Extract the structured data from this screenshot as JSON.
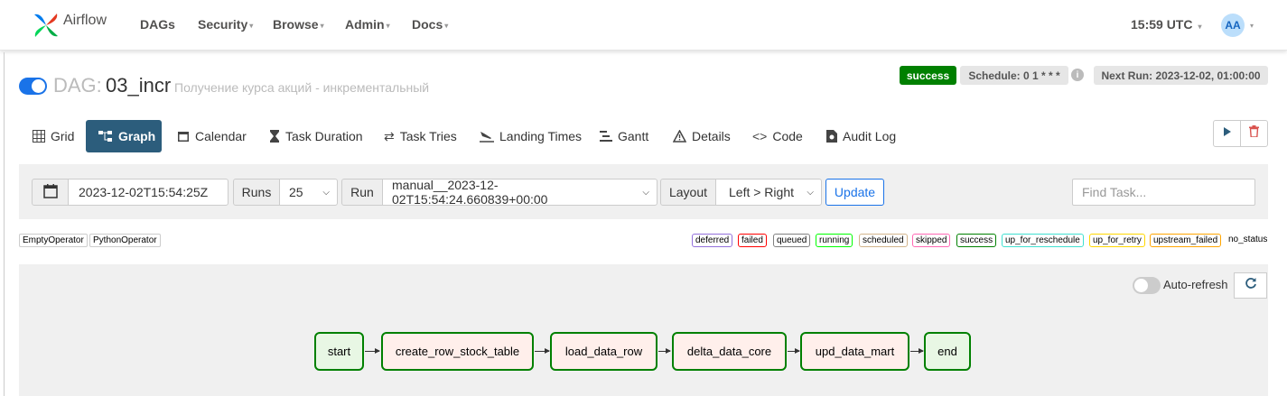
{
  "navbar": {
    "brand": "Airflow",
    "items": [
      "DAGs",
      "Security",
      "Browse",
      "Admin",
      "Docs"
    ],
    "time": "15:59 UTC",
    "avatar": "AA"
  },
  "dag": {
    "prefix": "DAG:",
    "id": "03_incr",
    "description": "Получение курса акций - инкрементальный",
    "status": "success",
    "schedule": "Schedule: 0 1 * * *",
    "next_run": "Next Run: 2023-12-02, 01:00:00",
    "paused": false
  },
  "tabs": [
    {
      "label": "Grid",
      "icon": "grid-icon"
    },
    {
      "label": "Graph",
      "icon": "graph-icon",
      "active": true
    },
    {
      "label": "Calendar",
      "icon": "calendar-icon"
    },
    {
      "label": "Task Duration",
      "icon": "hourglass-icon"
    },
    {
      "label": "Task Tries",
      "icon": "repeat-icon"
    },
    {
      "label": "Landing Times",
      "icon": "plane-icon"
    },
    {
      "label": "Gantt",
      "icon": "gantt-icon"
    },
    {
      "label": "Details",
      "icon": "warning-icon"
    },
    {
      "label": "Code",
      "icon": "code-icon"
    },
    {
      "label": "Audit Log",
      "icon": "file-icon"
    }
  ],
  "filters": {
    "date": "2023-12-02T15:54:25Z",
    "runs_label": "Runs",
    "runs_value": "25",
    "run_label": "Run",
    "run_value": "manual__2023-12-02T15:54:24.660839+00:00",
    "layout_label": "Layout",
    "layout_value": "Left > Right",
    "update_label": "Update",
    "find_placeholder": "Find Task..."
  },
  "operators": [
    {
      "label": "EmptyOperator",
      "color": "#e8f7e4"
    },
    {
      "label": "PythonOperator",
      "color": "#ffefeb"
    }
  ],
  "states": [
    {
      "label": "deferred",
      "color": "#9370db"
    },
    {
      "label": "failed",
      "color": "#ff0000"
    },
    {
      "label": "queued",
      "color": "#808080"
    },
    {
      "label": "running",
      "color": "#00ff00"
    },
    {
      "label": "scheduled",
      "color": "#d2b48c"
    },
    {
      "label": "skipped",
      "color": "#ff69b4"
    },
    {
      "label": "success",
      "color": "#008000"
    },
    {
      "label": "up_for_reschedule",
      "color": "#40e0d0"
    },
    {
      "label": "up_for_retry",
      "color": "#ffd700"
    },
    {
      "label": "upstream_failed",
      "color": "#ffa500"
    },
    {
      "label": "no_status",
      "color": "#ffffff"
    }
  ],
  "graph": {
    "auto_refresh": "Auto-refresh",
    "nodes": [
      {
        "label": "start",
        "operator": "EmptyOperator"
      },
      {
        "label": "create_row_stock_table",
        "operator": "PythonOperator"
      },
      {
        "label": "load_data_row",
        "operator": "PythonOperator"
      },
      {
        "label": "delta_data_core",
        "operator": "PythonOperator"
      },
      {
        "label": "upd_data_mart",
        "operator": "PythonOperator"
      },
      {
        "label": "end",
        "operator": "EmptyOperator"
      }
    ]
  },
  "colors": {
    "accent": "#2c5d7c",
    "success": "#008000",
    "toggle_on": "#1a73e8",
    "delete": "#d9534f"
  }
}
